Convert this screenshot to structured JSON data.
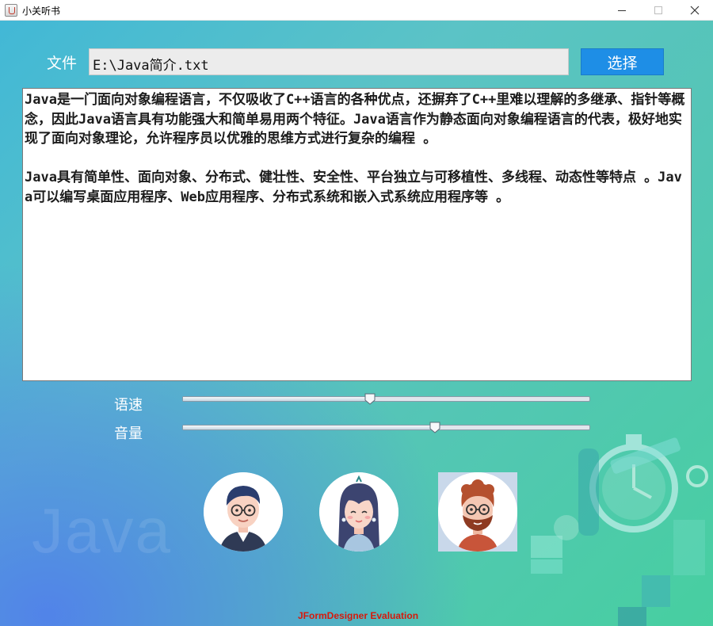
{
  "window": {
    "title": "小关听书"
  },
  "file": {
    "label": "文件",
    "path": "E:\\Java简介.txt",
    "choose_label": "选择"
  },
  "text": {
    "paragraphs": [
      "Java是一门面向对象编程语言，不仅吸收了C++语言的各种优点，还摒弃了C++里难以理解的多继承、指针等概念，因此Java语言具有功能强大和简单易用两个特征。Java语言作为静态面向对象编程语言的代表，极好地实现了面向对象理论，允许程序员以优雅的思维方式进行复杂的编程 。",
      "Java具有简单性、面向对象、分布式、健壮性、安全性、平台独立与可移植性、多线程、动态性等特点 。Java可以编写桌面应用程序、Web应用程序、分布式系统和嵌入式系统应用程序等 。"
    ]
  },
  "controls": {
    "speed": {
      "label": "语速",
      "value": 0.46
    },
    "volume": {
      "label": "音量",
      "value": 0.62
    }
  },
  "voices": [
    {
      "icon": "man-glasses-avatar-icon"
    },
    {
      "icon": "woman-long-hair-avatar-icon"
    },
    {
      "icon": "man-beard-avatar-icon",
      "selected": true
    }
  ],
  "footer": {
    "watermark": "JFormDesigner Evaluation"
  },
  "colors": {
    "button": "#1e8ee6",
    "watermark": "#d6190b",
    "gradient_start": "#42b8d6",
    "gradient_end": "#47cfa0"
  }
}
